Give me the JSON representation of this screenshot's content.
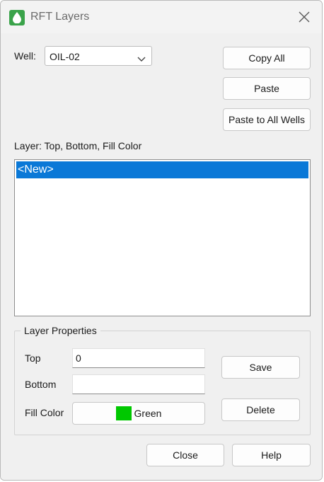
{
  "window": {
    "title": "RFT Layers",
    "app_icon": "droplet-icon",
    "close_icon": "close-icon"
  },
  "well": {
    "label": "Well:",
    "selected": "OIL-02"
  },
  "buttons": {
    "copy_all": "Copy All",
    "paste": "Paste",
    "paste_all_wells": "Paste to All Wells",
    "save": "Save",
    "delete": "Delete",
    "close": "Close",
    "help": "Help"
  },
  "layers": {
    "header": "Layer: Top, Bottom, Fill Color",
    "items": [
      "<New>"
    ],
    "selected_index": 0
  },
  "properties": {
    "legend": "Layer Properties",
    "top_label": "Top",
    "top_value": "0",
    "bottom_label": "Bottom",
    "bottom_value": "",
    "fill_label": "Fill Color",
    "fill_name": "Green",
    "fill_color": "#00c800"
  },
  "colors": {
    "selection": "#0a78d7",
    "window_bg": "#f0f0f0"
  }
}
